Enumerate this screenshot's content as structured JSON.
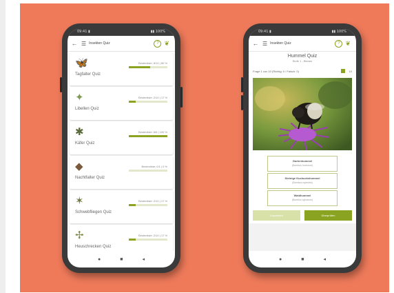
{
  "left_phone": {
    "status_left": "09:41 ▮",
    "status_right": "▮▮ 100%",
    "appbar_title": "Insekten Quiz",
    "help_icon": "?",
    "menu_icon": "menu-icon",
    "items": [
      {
        "label": "Tagfalter Quiz",
        "score": "Bestenliste: 8/10 | 80 %",
        "progress": 0.55,
        "icon": "butterfly-icon",
        "glyph": "🦋"
      },
      {
        "label": "Libellen Quiz",
        "score": "Bestenliste: 2/10 | 17 %",
        "progress": 0.18,
        "icon": "dragonfly-icon",
        "glyph": "✦"
      },
      {
        "label": "Käfer Quiz",
        "score": "Bestenliste: 6/6 | 100 %",
        "progress": 1.0,
        "icon": "beetle-icon",
        "glyph": "✱"
      },
      {
        "label": "Nachtfalter Quiz",
        "score": "Bestenliste: 0/1 | 0 %",
        "progress": 0.0,
        "icon": "moth-icon",
        "glyph": "◆"
      },
      {
        "label": "Schwebfliegen Quiz",
        "score": "Bestenliste: 2/10 | 17 %",
        "progress": 0.18,
        "icon": "hoverfly-icon",
        "glyph": "✶"
      },
      {
        "label": "Heuschrecken Quiz",
        "score": "Bestenliste: 2/10 | 17 %",
        "progress": 0.18,
        "icon": "grasshopper-icon",
        "glyph": "✢"
      }
    ],
    "nav": [
      "●",
      "■",
      "◂"
    ]
  },
  "right_phone": {
    "status_left": "09:41 ▮",
    "status_right": "▮▮ 100%",
    "appbar_title": "Insekten Quiz",
    "help_icon": "?",
    "quiz_title": "Hummel Quiz",
    "quiz_subtitle": "Stufe 1 - Bienen",
    "question_text": "Frage 1 von 10 (Richtig: 0 / Falsch: 0)",
    "question_count": "10",
    "answers": [
      {
        "name": "Gartenhummel",
        "latin": "(Bombus hortorum)"
      },
      {
        "name": "Steinige Kuckuckshummel",
        "latin": "(Bombus rupestris)"
      },
      {
        "name": "Waldhummel",
        "latin": "(Bombus sylvarum)"
      }
    ],
    "btn_left": "Auswerten",
    "btn_right": "Überprüfen",
    "nav": [
      "●",
      "■",
      "◂"
    ]
  }
}
